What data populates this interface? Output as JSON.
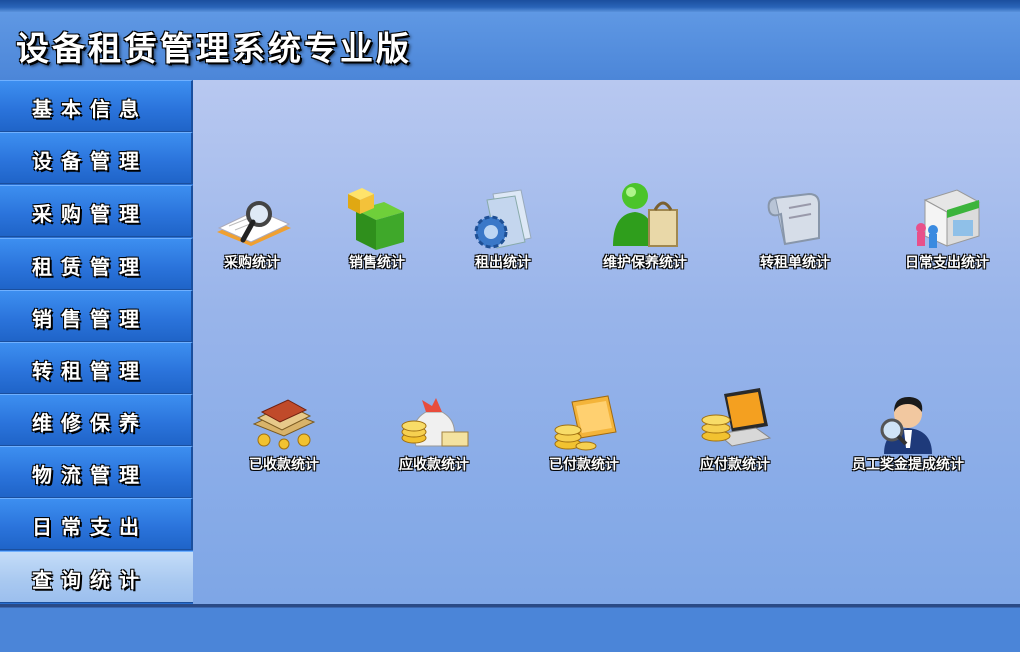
{
  "app": {
    "title": "设备租赁管理系统专业版"
  },
  "sidebar": {
    "items": [
      {
        "label": "基本信息"
      },
      {
        "label": "设备管理"
      },
      {
        "label": "采购管理"
      },
      {
        "label": "租赁管理"
      },
      {
        "label": "销售管理"
      },
      {
        "label": "转租管理"
      },
      {
        "label": "维修保养"
      },
      {
        "label": "物流管理"
      },
      {
        "label": "日常支出"
      },
      {
        "label": "查询统计",
        "active": true
      }
    ]
  },
  "main": {
    "row1": [
      {
        "label": "采购统计",
        "icon": "magnifier-notebook-icon"
      },
      {
        "label": "销售统计",
        "icon": "green-boxes-icon"
      },
      {
        "label": "租出统计",
        "icon": "gear-folder-icon"
      },
      {
        "label": "维护保养统计",
        "icon": "user-shopping-bag-icon"
      },
      {
        "label": "转租单统计",
        "icon": "paper-roll-icon"
      },
      {
        "label": "日常支出统计",
        "icon": "shop-icon"
      }
    ],
    "row2": [
      {
        "label": "已收款统计",
        "icon": "money-bundle-icon"
      },
      {
        "label": "应收款统计",
        "icon": "money-bag-icon"
      },
      {
        "label": "已付款统计",
        "icon": "coins-card-icon"
      },
      {
        "label": "应付款统计",
        "icon": "coins-laptop-icon"
      },
      {
        "label": "员工奖金提成统计",
        "icon": "employee-search-icon"
      }
    ]
  },
  "colors": {
    "header": "#4c86d8",
    "sidebar": "#2b74dc",
    "active_item": "#a8c8f0"
  }
}
